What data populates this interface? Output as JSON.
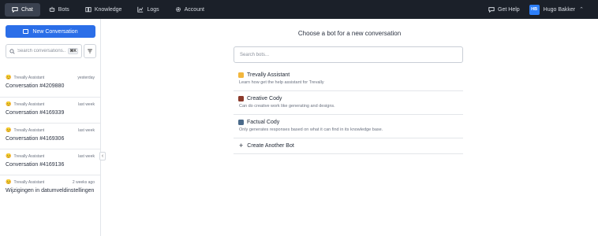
{
  "nav": {
    "items": [
      {
        "label": "Chat",
        "icon": "chat-icon",
        "active": true
      },
      {
        "label": "Bots",
        "icon": "bot-icon",
        "active": false
      },
      {
        "label": "Knowledge",
        "icon": "book-icon",
        "active": false
      },
      {
        "label": "Logs",
        "icon": "chart-icon",
        "active": false
      },
      {
        "label": "Account",
        "icon": "gear-icon",
        "active": false
      }
    ],
    "help_label": "Get Help",
    "user_initials": "HB",
    "user_name": "Hugo Bakker"
  },
  "sidebar": {
    "new_conversation_label": "New Conversation",
    "search_placeholder": "Search conversations...",
    "shortcut": "⌘K",
    "conversations": [
      {
        "bot": "Trevally Assistant",
        "time": "yesterday",
        "title": "Conversation #4209880"
      },
      {
        "bot": "Trevally Assistant",
        "time": "last week",
        "title": "Conversation #4169339"
      },
      {
        "bot": "Trevally Assistant",
        "time": "last week",
        "title": "Conversation #4169306"
      },
      {
        "bot": "Trevally Assistant",
        "time": "last week",
        "title": "Conversation #4169136"
      },
      {
        "bot": "Trevally Assistant",
        "time": "2 weeks ago",
        "title": "Wijzigingen in datumveldinstellingen"
      }
    ]
  },
  "main": {
    "heading": "Choose a bot for a new conversation",
    "search_placeholder": "Search bots...",
    "bots": [
      {
        "name": "Trevally Assistant",
        "description": "Learn how get the help assistant for Trevally",
        "color": "#f2b63c"
      },
      {
        "name": "Creative Cody",
        "description": "Can do creative work like generating and designs.",
        "color": "#8b3a2b"
      },
      {
        "name": "Factual Cody",
        "description": "Only generates responses based on what it can find in its knowledge base.",
        "color": "#4a6a8a"
      }
    ],
    "create_label": "Create Another Bot"
  },
  "colors": {
    "accent": "#2b6ee8",
    "topbar": "#1b2029"
  }
}
